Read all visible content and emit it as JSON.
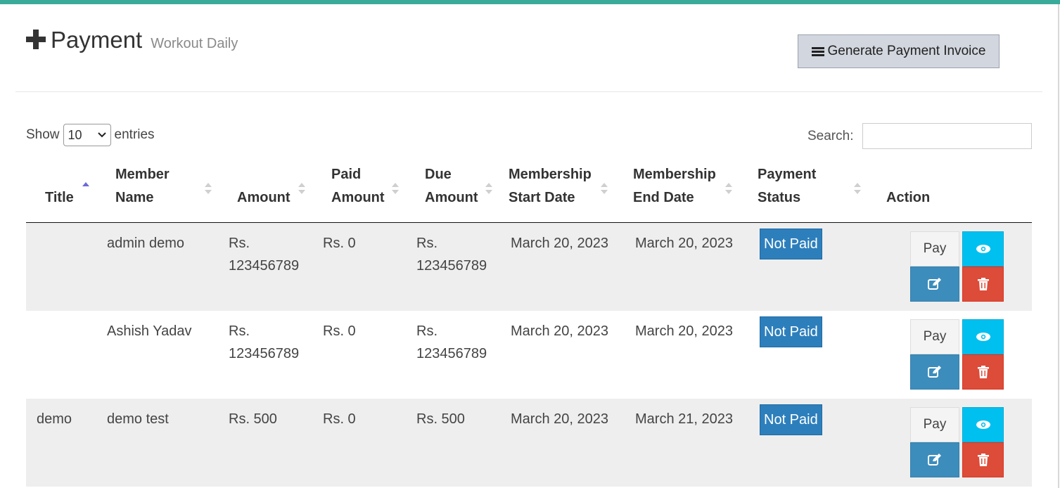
{
  "header": {
    "title": "Payment",
    "subtitle": "Workout Daily",
    "generate_button_label": "Generate Payment Invoice"
  },
  "controls": {
    "show_label": "Show",
    "entries_value": "10",
    "entries_label": "entries",
    "search_label": "Search:",
    "search_value": ""
  },
  "table": {
    "columns": {
      "title": "Title",
      "member_name_1": "Member",
      "member_name_2": "Name",
      "amount": "Amount",
      "paid_amount_1": "Paid",
      "paid_amount_2": "Amount",
      "due_amount_1": "Due",
      "due_amount_2": "Amount",
      "start_date_1": "Membership",
      "start_date_2": "Start Date",
      "end_date_1": "Membership",
      "end_date_2": "End Date",
      "payment_status_1": "Payment",
      "payment_status_2": "Status",
      "action": "Action"
    },
    "rows": [
      {
        "title": "",
        "member": "admin demo",
        "amount_1": "Rs.",
        "amount_2": "123456789",
        "paid": "Rs. 0",
        "due_1": "Rs.",
        "due_2": "123456789",
        "start": "March 20, 2023",
        "end": "March 20, 2023",
        "status": "Not Paid",
        "pay_label": "Pay"
      },
      {
        "title": "",
        "member": "Ashish Yadav",
        "amount_1": "Rs.",
        "amount_2": "123456789",
        "paid": "Rs. 0",
        "due_1": "Rs.",
        "due_2": "123456789",
        "start": "March 20, 2023",
        "end": "March 20, 2023",
        "status": "Not Paid",
        "pay_label": "Pay"
      },
      {
        "title": "demo",
        "member": "demo test",
        "amount_1": "Rs. 500",
        "amount_2": "",
        "paid": "Rs. 0",
        "due_1": "Rs. 500",
        "due_2": "",
        "start": "March 20, 2023",
        "end": "March 21, 2023",
        "status": "Not Paid",
        "pay_label": "Pay"
      }
    ]
  },
  "colors": {
    "accent_top": "#3aab9b",
    "status_badge": "#2d7fbc",
    "view_button": "#00c0ef",
    "edit_button": "#3c8dbc",
    "delete_button": "#dd4b39"
  },
  "icons": [
    "plus-icon",
    "bars-icon",
    "sort-asc-icon",
    "sort-both-icon",
    "eye-icon",
    "edit-icon",
    "trash-icon",
    "chevron-down-icon"
  ]
}
